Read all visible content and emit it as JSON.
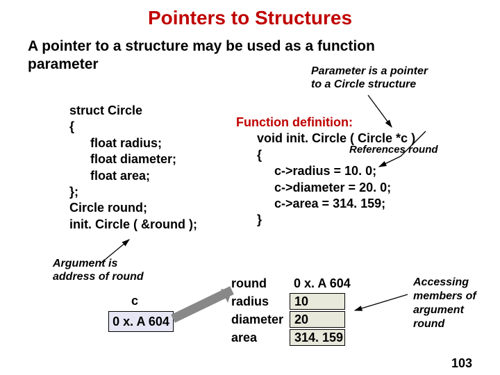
{
  "title": "Pointers to Structures",
  "intro_l1": "A pointer to a structure may be used as a function",
  "intro_l2": "parameter",
  "note_param_l1": "Parameter is a pointer",
  "note_param_l2": "to a Circle structure",
  "struct": {
    "l1": "struct Circle",
    "l2": "{",
    "l3": "float radius;",
    "l4": "float diameter;",
    "l5": "float area;",
    "l6": "};",
    "l7": "Circle round;",
    "l8": "init. Circle ( &round );"
  },
  "func": {
    "header": "Function definition:",
    "sig": "void init. Circle ( Circle *c )",
    "open": "{",
    "b1": "c->radius = 10. 0;",
    "b2": "c->diameter = 20. 0;",
    "b3": "c->area = 314. 159;",
    "close": "}"
  },
  "note_ref": "References round",
  "note_arg_l1": "Argument is",
  "note_arg_l2": "address of round",
  "c_label": "c",
  "addr": "0 x. A 604",
  "mem": {
    "round_label": "round",
    "round_addr": "0 x. A 604",
    "rows": [
      {
        "name": "radius",
        "val": "10"
      },
      {
        "name": "diameter",
        "val": "20"
      },
      {
        "name": "area",
        "val": "314. 159"
      }
    ]
  },
  "note_access_l1": "Accessing",
  "note_access_l2": "members of",
  "note_access_l3": "argument",
  "note_access_l4": "round",
  "page": "103"
}
